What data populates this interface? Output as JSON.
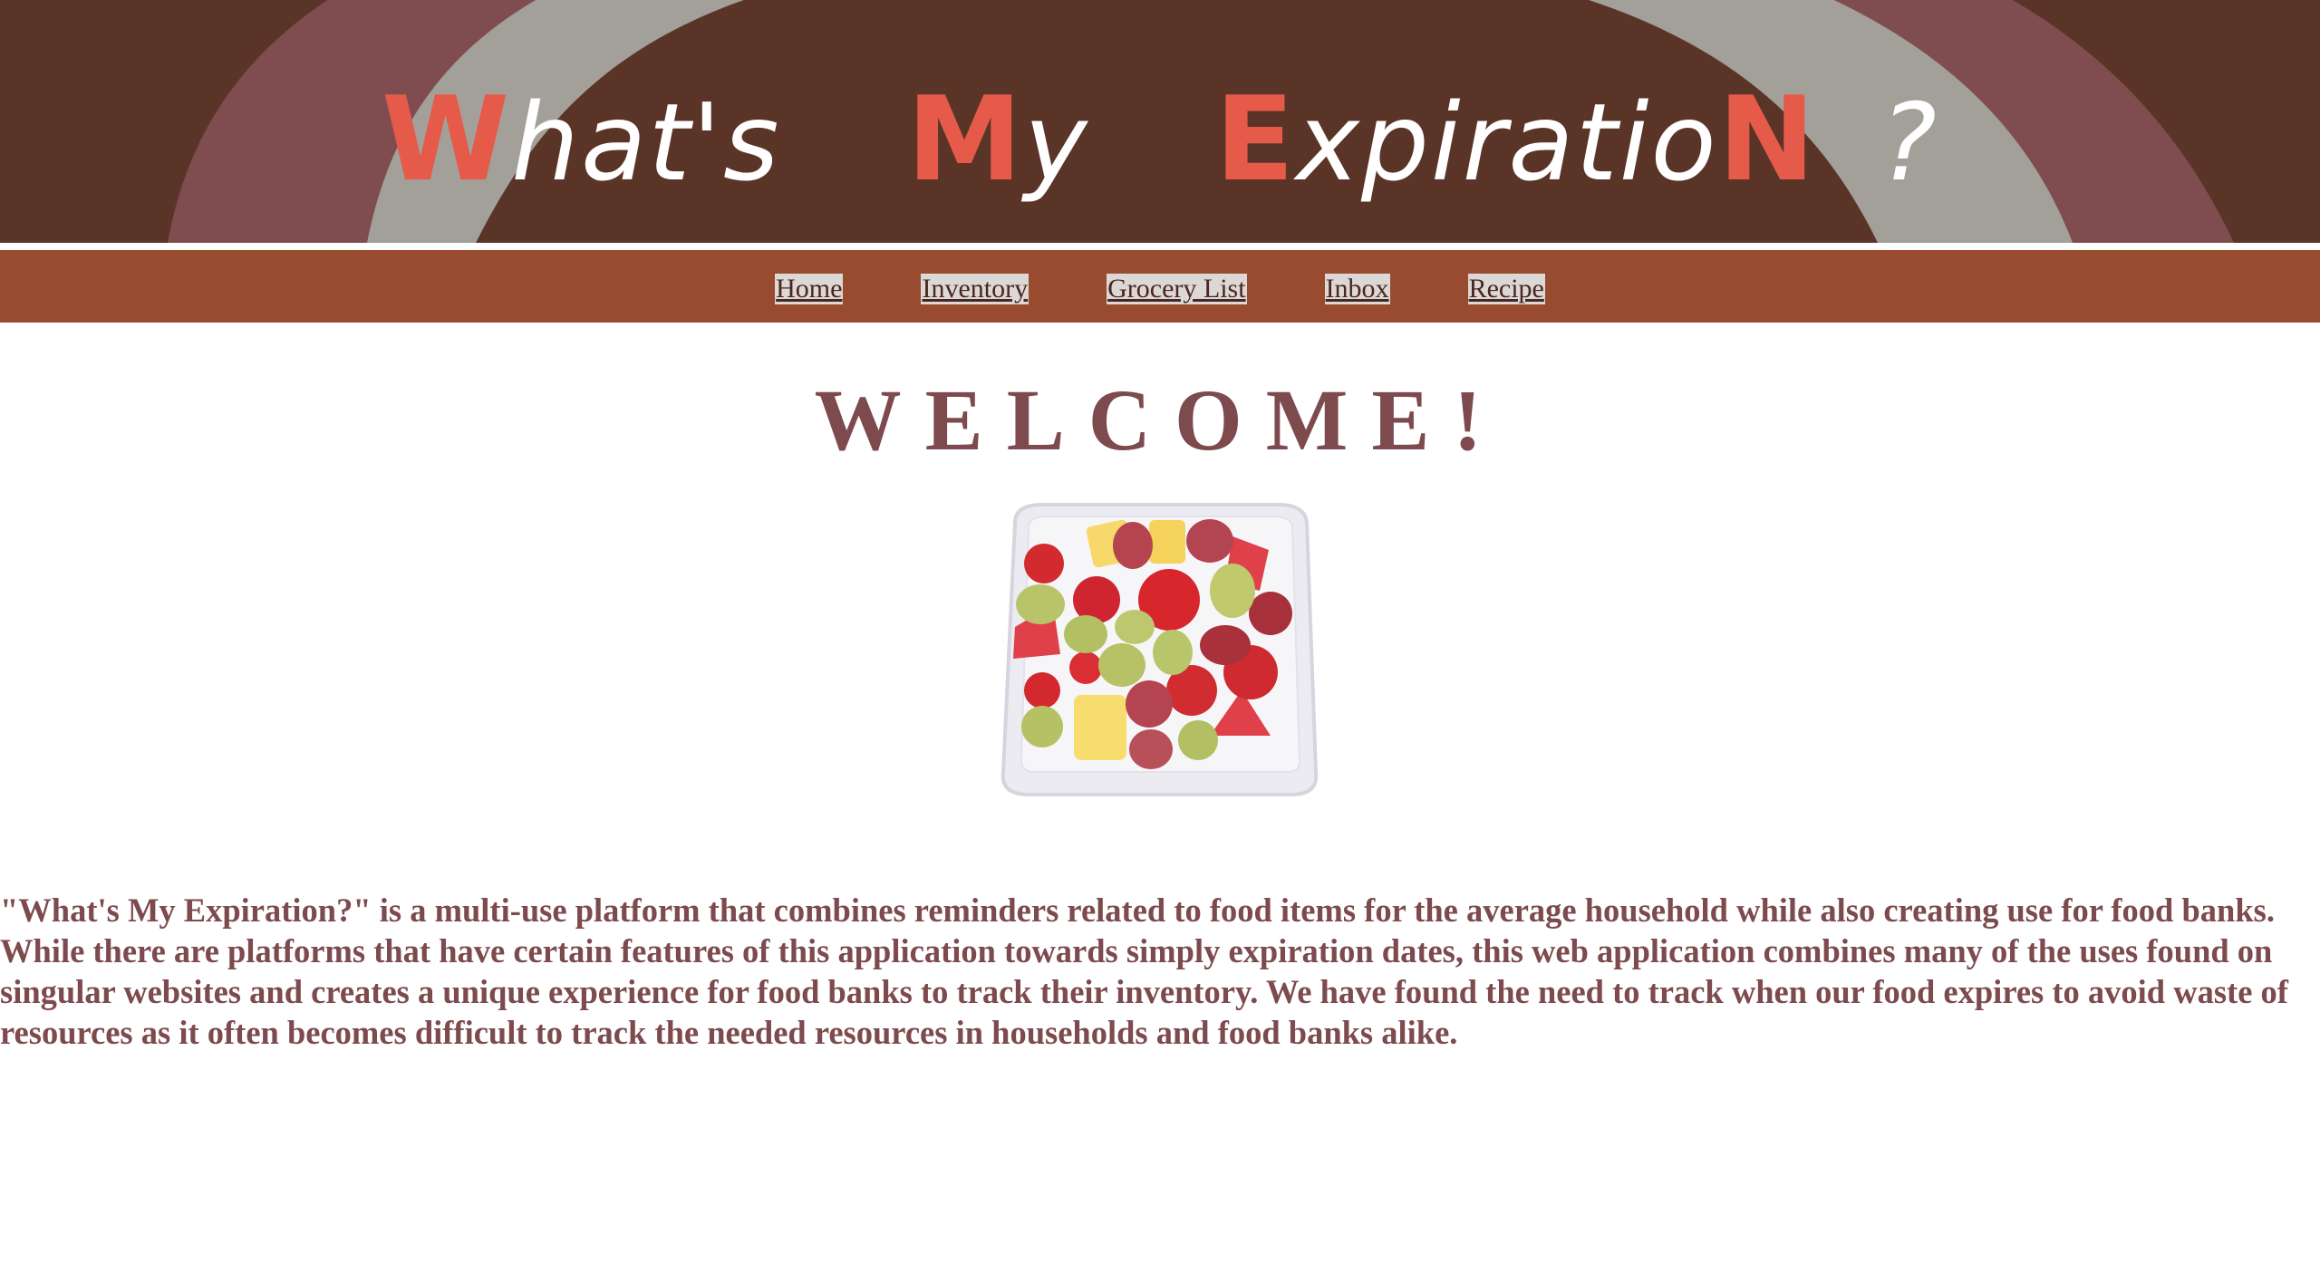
{
  "site": {
    "logo_words": [
      {
        "cap": "W",
        "rest": "hat's"
      },
      {
        "cap": "M",
        "rest": "y"
      },
      {
        "cap": "E",
        "rest": "xpiratio"
      }
    ],
    "logo_tail_cap": "N",
    "logo_mark": "?"
  },
  "nav": {
    "items": [
      {
        "label": "Home"
      },
      {
        "label": "Inventory"
      },
      {
        "label": "Grocery List"
      },
      {
        "label": "Inbox"
      },
      {
        "label": "Recipe"
      }
    ]
  },
  "main": {
    "heading": "WELCOME!",
    "image_subject": "fruit-salad-container",
    "description": "\"What's My Expiration?\" is a multi-use platform that combines reminders related to food items for the average household while also creating use for food banks. While there are platforms that have certain features of this application towards simply expiration dates, this web application combines many of the uses found on singular websites and creates a unique experience for food banks to track their inventory. We have found the need to track when our food expires to avoid waste of resources as it often becomes difficult to track the needed resources in households and food banks alike."
  },
  "colors": {
    "banner_bg": "#5b3428",
    "arc_outer": "#7f4d4f",
    "arc_inner": "#a39f99",
    "logo_accent": "#e65a4a",
    "nav_bg": "#984b2e",
    "text_accent": "#7d4a4d"
  }
}
